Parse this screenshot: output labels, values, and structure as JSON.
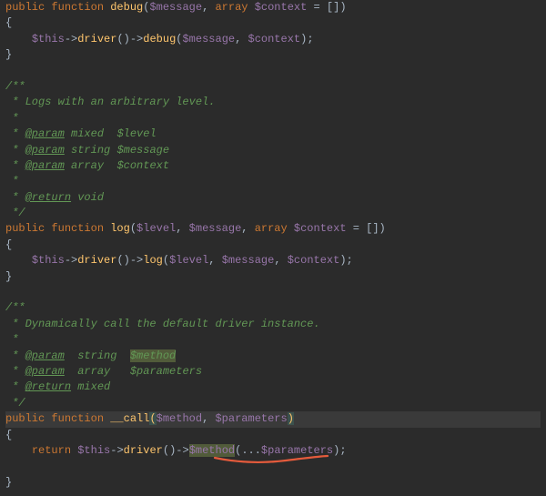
{
  "kw": {
    "public": "public",
    "function": "function",
    "array": "array",
    "return": "return",
    "mixed": "mixed",
    "string": "string",
    "void": "void"
  },
  "fn": {
    "debug": "debug",
    "log": "log",
    "call": "__call",
    "driver": "driver"
  },
  "var": {
    "message": "$message",
    "context": "$context",
    "thisv": "$this",
    "level": "$level",
    "method": "$method",
    "parameters": "$parameters"
  },
  "doc": {
    "open": "/**",
    "star": " *",
    "close": " */",
    "line1": " Logs with an arbitrary level.",
    "line2": " Dynamically call the default driver instance.",
    "at_param": "@param",
    "at_return": "@return",
    "p_mixed_level": " mixed  $level",
    "p_string_message": " string $message",
    "p_array_context": " array  $context",
    "p_string_method": "  string  ",
    "p_array_parameters": "  array   ",
    "p_method": "$method",
    "p_parameters": "$parameters",
    "r_void": " void",
    "r_mixed": " mixed"
  },
  "punct": {
    "lparen": "(",
    "rparen": ")",
    "lbrace": "{",
    "rbrace": "}",
    "comma": ", ",
    "arrow": "->",
    "semi": ";",
    "eq": " = ",
    "lbracket": "[",
    "rbracket": "]",
    "dots": "..."
  }
}
